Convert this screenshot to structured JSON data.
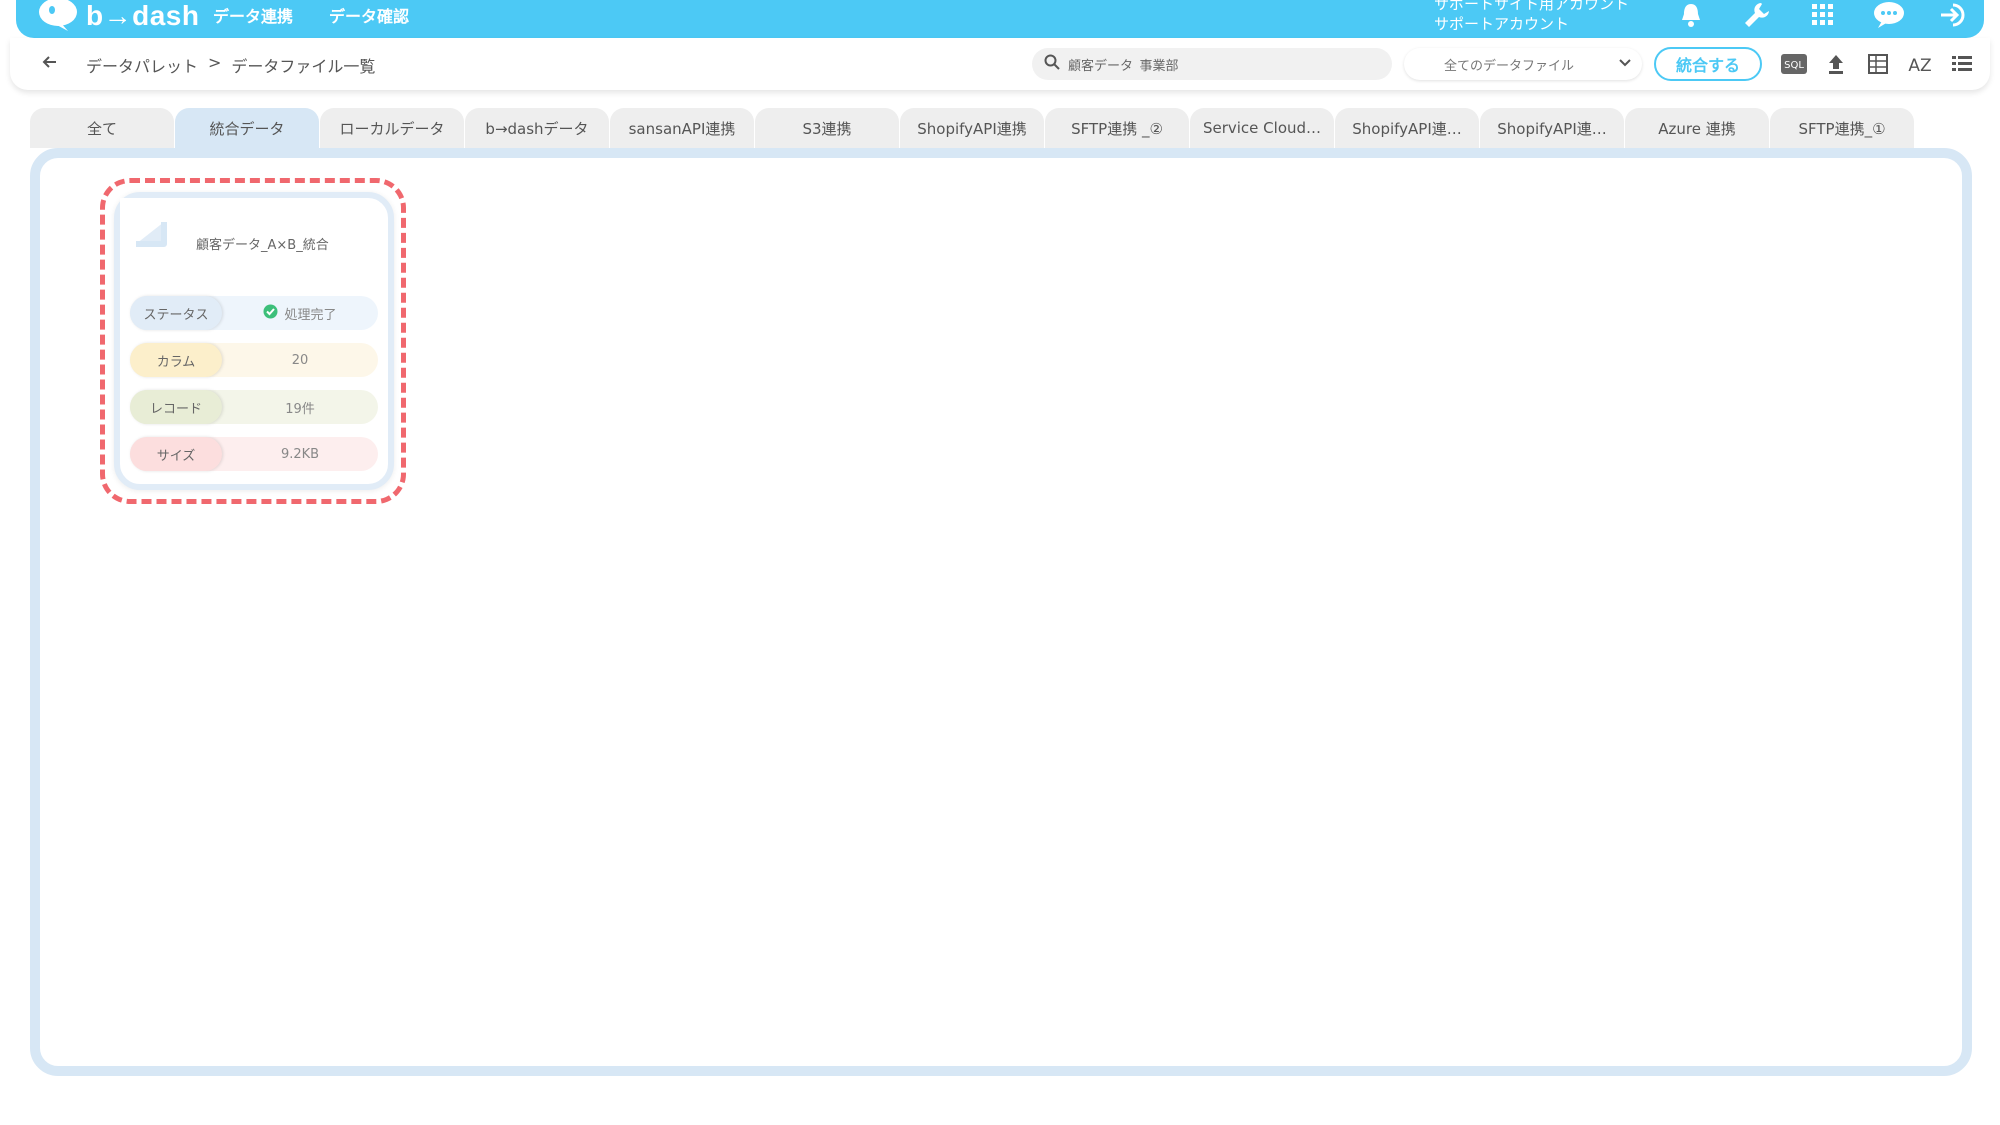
{
  "header": {
    "brand": "b→dash",
    "nav": [
      "データ連携",
      "データ確認"
    ],
    "account_line1": "サポートサイト用アカウント",
    "account_line2": "サポートアカウント",
    "icons": [
      "bell-icon",
      "wrench-icon",
      "grid-icon",
      "chat-icon",
      "logout-icon"
    ]
  },
  "subheader": {
    "breadcrumb": [
      "データパレット",
      ">",
      "データファイル一覧"
    ],
    "search_value": "顧客データ_事業部",
    "file_filter": "全てのデータファイル",
    "merge_button": "統合する",
    "tool_icons": [
      "sql-icon",
      "upload-icon",
      "table-icon",
      "sort-az-icon",
      "list-icon"
    ],
    "sort_label": "AZ",
    "sql_label": "SQL"
  },
  "tabs": [
    {
      "label": "全て",
      "active": false
    },
    {
      "label": "統合データ",
      "active": true
    },
    {
      "label": "ローカルデータ",
      "active": false
    },
    {
      "label": "b→dashデータ",
      "active": false
    },
    {
      "label": "sansanAPI連携",
      "active": false
    },
    {
      "label": "S3連携",
      "active": false
    },
    {
      "label": "ShopifyAPI連携",
      "active": false
    },
    {
      "label": "SFTP連携 _②",
      "active": false
    },
    {
      "label": "Service Cloud…",
      "active": false
    },
    {
      "label": "ShopifyAPI連…",
      "active": false
    },
    {
      "label": "ShopifyAPI連…",
      "active": false
    },
    {
      "label": "Azure 連携",
      "active": false
    },
    {
      "label": "SFTP連携_①",
      "active": false
    }
  ],
  "card": {
    "title": "顧客データ_A×B_統合",
    "rows": [
      {
        "label": "ステータス",
        "value": "処理完了"
      },
      {
        "label": "カラム",
        "value": "20"
      },
      {
        "label": "レコード",
        "value": "19件"
      },
      {
        "label": "サイズ",
        "value": "9.2KB"
      }
    ]
  },
  "colors": {
    "brand": "#4cc9f5",
    "tab_active": "#d7e7f5",
    "highlight": "#f0686e",
    "status_ok": "#3cbf7a"
  }
}
